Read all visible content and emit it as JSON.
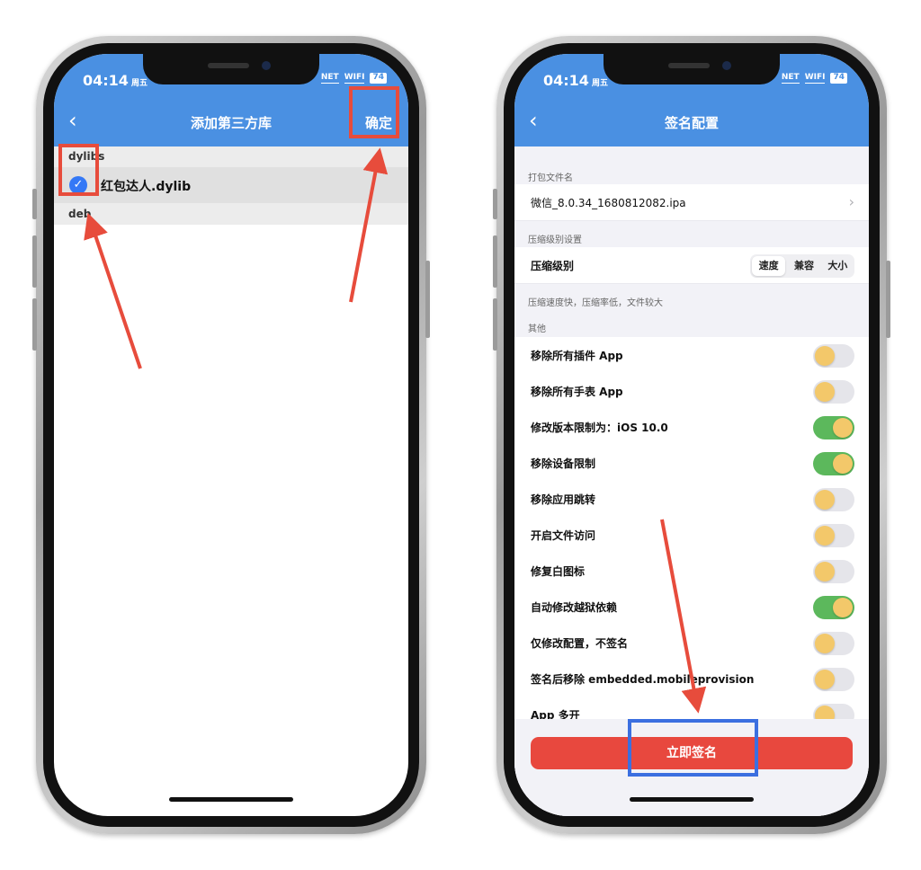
{
  "left_phone": {
    "status": {
      "time": "04:14",
      "day": "周五",
      "net": "NET",
      "wifi": "WIFI",
      "battery": "74"
    },
    "nav": {
      "back_icon": "chevron-left-icon",
      "title": "添加第三方库",
      "confirm_label": "确定"
    },
    "sections": [
      {
        "header": "dylibs",
        "items": [
          {
            "label": "红包达人.dylib",
            "checked": true
          }
        ]
      },
      {
        "header": "deb",
        "items": []
      }
    ]
  },
  "right_phone": {
    "status": {
      "time": "04:14",
      "day": "周五",
      "net": "NET",
      "wifi": "WIFI",
      "battery": "74"
    },
    "nav": {
      "back_icon": "chevron-left-icon",
      "title": "签名配置"
    },
    "package_group_label": "打包文件名",
    "package_filename": "微信_8.0.34_1680812082.ipa",
    "compress_group_label": "压缩级别设置",
    "compress_label": "压缩级别",
    "compress_options": [
      "速度",
      "兼容",
      "大小"
    ],
    "compress_selected": "速度",
    "compress_note": "压缩速度快，压缩率低，文件较大",
    "other_group_label": "其他",
    "toggles": [
      {
        "label": "移除所有插件 App",
        "on": false
      },
      {
        "label": "移除所有手表 App",
        "on": false
      },
      {
        "label": "修改版本限制为：iOS 10.0",
        "on": true
      },
      {
        "label": "移除设备限制",
        "on": true
      },
      {
        "label": "移除应用跳转",
        "on": false
      },
      {
        "label": "开启文件访问",
        "on": false
      },
      {
        "label": "修复白图标",
        "on": false
      },
      {
        "label": "自动修改越狱依赖",
        "on": true
      },
      {
        "label": "仅修改配置，不签名",
        "on": false
      },
      {
        "label": "签名后移除 embedded.mobileprovision",
        "on": false
      },
      {
        "label": "App 多开",
        "on": false
      }
    ],
    "sign_button_label": "立即签名"
  },
  "colors": {
    "nav_blue": "#4a90e2",
    "toggle_on": "#5cb85c",
    "knob": "#f3c86a",
    "sign_red": "#e8483e",
    "annotation_red": "#e74c3c",
    "annotation_blue": "#3b6fe0"
  }
}
